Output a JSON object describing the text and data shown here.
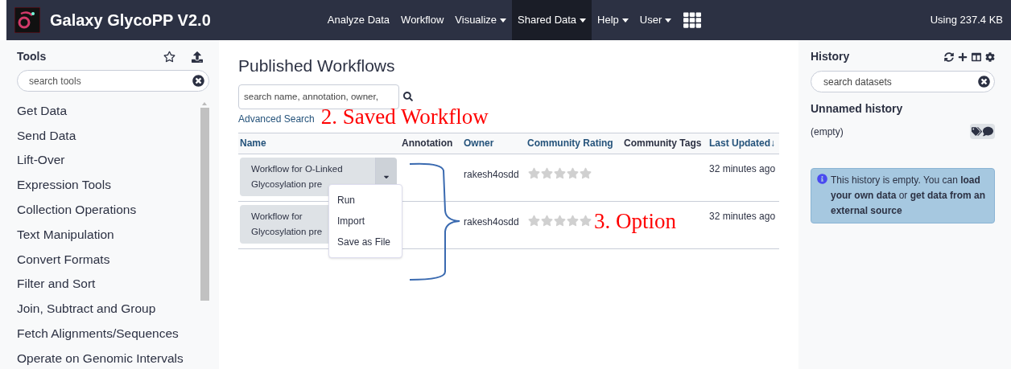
{
  "navbar": {
    "brand": "Galaxy GlycoPP V2.0",
    "items": [
      {
        "label": "Analyze Data",
        "caret": false,
        "selected": false
      },
      {
        "label": "Workflow",
        "caret": false,
        "selected": false
      },
      {
        "label": "Visualize",
        "caret": true,
        "selected": false
      },
      {
        "label": "Shared Data",
        "caret": true,
        "selected": true
      },
      {
        "label": "Help",
        "caret": true,
        "selected": false
      },
      {
        "label": "User",
        "caret": true,
        "selected": false
      }
    ],
    "usage": "Using 237.4 KB"
  },
  "tools": {
    "title": "Tools",
    "search_placeholder": "search tools",
    "items": [
      "Get Data",
      "Send Data",
      "Lift-Over",
      "Expression Tools",
      "Collection Operations",
      "Text Manipulation",
      "Convert Formats",
      "Filter and Sort",
      "Join, Subtract and Group",
      "Fetch Alignments/Sequences",
      "Operate on Genomic Intervals"
    ]
  },
  "main": {
    "title": "Published Workflows",
    "search_placeholder": "search name, annotation, owner,",
    "advanced_search": "Advanced Search",
    "columns": [
      {
        "label": "Name",
        "sortable": true
      },
      {
        "label": "Annotation",
        "sortable": false
      },
      {
        "label": "Owner",
        "sortable": true
      },
      {
        "label": "Community Rating",
        "sortable": true
      },
      {
        "label": "Community Tags",
        "sortable": false
      },
      {
        "label": "Last Updated↓",
        "sortable": true
      }
    ],
    "rows": [
      {
        "name_lines": [
          "Workflow for O-Linked",
          "Glycosylation pre"
        ],
        "owner": "rakesh4osdd",
        "stars": 0,
        "updated": "32 minutes ago",
        "dropdown_visible": true,
        "menu_open": true
      },
      {
        "name_lines": [
          "Workflow for",
          "Glycosylation pre"
        ],
        "owner": "rakesh4osdd",
        "stars": 0,
        "updated": "32 minutes ago",
        "dropdown_visible": false,
        "menu_open": false
      }
    ],
    "menu": [
      "Run",
      "Import",
      "Save as File"
    ]
  },
  "annotations": [
    "2. Saved Workflow",
    "3. Option"
  ],
  "history": {
    "title": "History",
    "search_placeholder": "search datasets",
    "name": "Unnamed history",
    "status": "(empty)",
    "message": "This history is empty. You can **load your own data** or **get data from an external source**"
  }
}
